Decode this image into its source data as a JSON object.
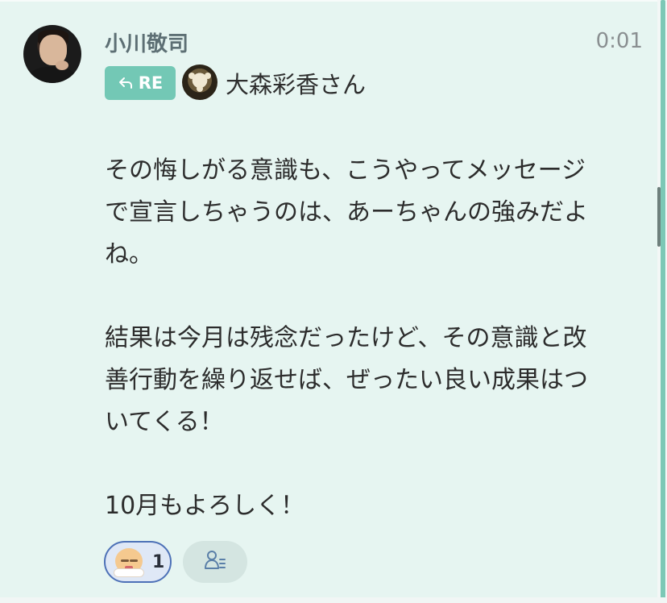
{
  "post": {
    "author": "小川敬司",
    "time": "0:01",
    "reply_badge": "RE",
    "reply_to": "大森彩香さん",
    "message_lines": [
      "その悔しがる意識も、こうやってメッセージ",
      "で宣言しちゃうのは、あーちゃんの強みだよ",
      "ね。",
      "",
      "結果は今月は残念だったけど、その意識と改",
      "善行動を繰り返せば、ぜったい良い成果はつ",
      "いてくる！",
      "",
      "10月もよろしく！"
    ]
  },
  "reactions": [
    {
      "emoji": "face-with-folded-hands",
      "count": "1"
    }
  ],
  "icons": {
    "reply": "reply-arrow-icon",
    "readers": "person-list-icon"
  },
  "colors": {
    "background": "#e6f5f1",
    "accent": "#73c8b5",
    "reaction_border": "#4d71b7"
  }
}
